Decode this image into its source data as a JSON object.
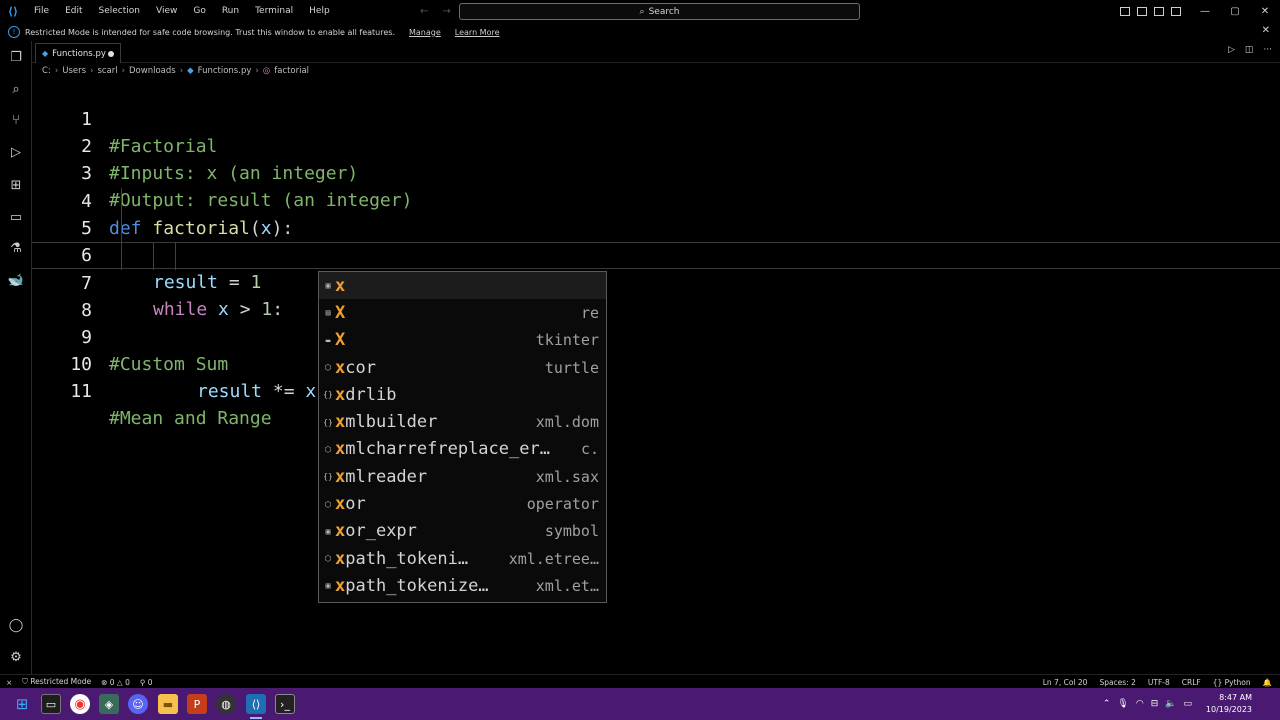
{
  "menu": [
    "File",
    "Edit",
    "Selection",
    "View",
    "Go",
    "Run",
    "Terminal",
    "Help"
  ],
  "search": {
    "label": "Search"
  },
  "banner": {
    "text": "Restricted Mode is intended for safe code browsing. Trust this window to enable all features.",
    "manage": "Manage",
    "learn_more": "Learn More"
  },
  "tab": {
    "filename": "Functions.py"
  },
  "breadcrumb": [
    "C:",
    "Users",
    "scarl",
    "Downloads",
    "Functions.py",
    "factorial"
  ],
  "code_lines": [
    {
      "num": "1",
      "text": "#Factorial"
    },
    {
      "num": "2",
      "text": "#Inputs: x (an integer)"
    },
    {
      "num": "3",
      "text": "#Output: result (an integer)"
    },
    {
      "num": "4",
      "text": "def factorial(x):"
    },
    {
      "num": "5",
      "text": "result = 1"
    },
    {
      "num": "6",
      "text": "while x > 1:"
    },
    {
      "num": "7",
      "text": "result *= x"
    },
    {
      "num": "8",
      "text": ""
    },
    {
      "num": "9",
      "text": "#Custom Sum"
    },
    {
      "num": "10",
      "text": ""
    },
    {
      "num": "11",
      "text": "#Mean and Range"
    }
  ],
  "code": {
    "l4_def": "def",
    "l4_name": "factorial",
    "l4_open": "(",
    "l4_param": "x",
    "l4_close": "):",
    "l5_var": "result",
    "l5_op": " = ",
    "l5_num": "1",
    "l6_kw": "while",
    "l6_var": "x",
    "l6_op": " > ",
    "l6_num": "1",
    "l6_colon": ":",
    "l7_var": "result",
    "l7_op": " *= ",
    "l7_var2": "x"
  },
  "suggestions": [
    {
      "icon": "variable-icon",
      "glyph": "▣",
      "match": "x",
      "rest": "",
      "detail": ""
    },
    {
      "icon": "module-icon",
      "glyph": "▤",
      "match": "X",
      "rest": "",
      "detail": "re"
    },
    {
      "icon": "module-icon",
      "glyph": "▬",
      "match": "X",
      "rest": "",
      "detail": "tkinter"
    },
    {
      "icon": "method-icon",
      "glyph": "⬡",
      "match": "x",
      "rest": "cor",
      "detail": "turtle"
    },
    {
      "icon": "namespace-icon",
      "glyph": "{}",
      "match": "x",
      "rest": "drlib",
      "detail": ""
    },
    {
      "icon": "namespace-icon",
      "glyph": "{}",
      "match": "x",
      "rest": "mlbuilder",
      "detail": "xml.dom"
    },
    {
      "icon": "method-icon",
      "glyph": "⬡",
      "match": "x",
      "rest": "mlcharrefreplace_er…",
      "detail": "c."
    },
    {
      "icon": "namespace-icon",
      "glyph": "{}",
      "match": "x",
      "rest": "mlreader",
      "detail": "xml.sax"
    },
    {
      "icon": "method-icon",
      "glyph": "⬡",
      "match": "x",
      "rest": "or",
      "detail": "operator"
    },
    {
      "icon": "variable-icon",
      "glyph": "▣",
      "match": "x",
      "rest": "or_expr",
      "detail": "symbol"
    },
    {
      "icon": "method-icon",
      "glyph": "⬡",
      "match": "x",
      "rest": "path_tokeni…",
      "detail": "xml.etree…"
    },
    {
      "icon": "variable-icon",
      "glyph": "▣",
      "match": "x",
      "rest": "path_tokenize…",
      "detail": "xml.et…"
    }
  ],
  "status": {
    "restricted": "Restricted Mode",
    "errors": "0",
    "warnings": "0",
    "ports": "0",
    "position": "Ln 7, Col 20",
    "spaces": "Spaces: 2",
    "encoding": "UTF-8",
    "eol": "CRLF",
    "language": "Python"
  },
  "clock": {
    "time": "8:47 AM",
    "date": "10/19/2023"
  }
}
